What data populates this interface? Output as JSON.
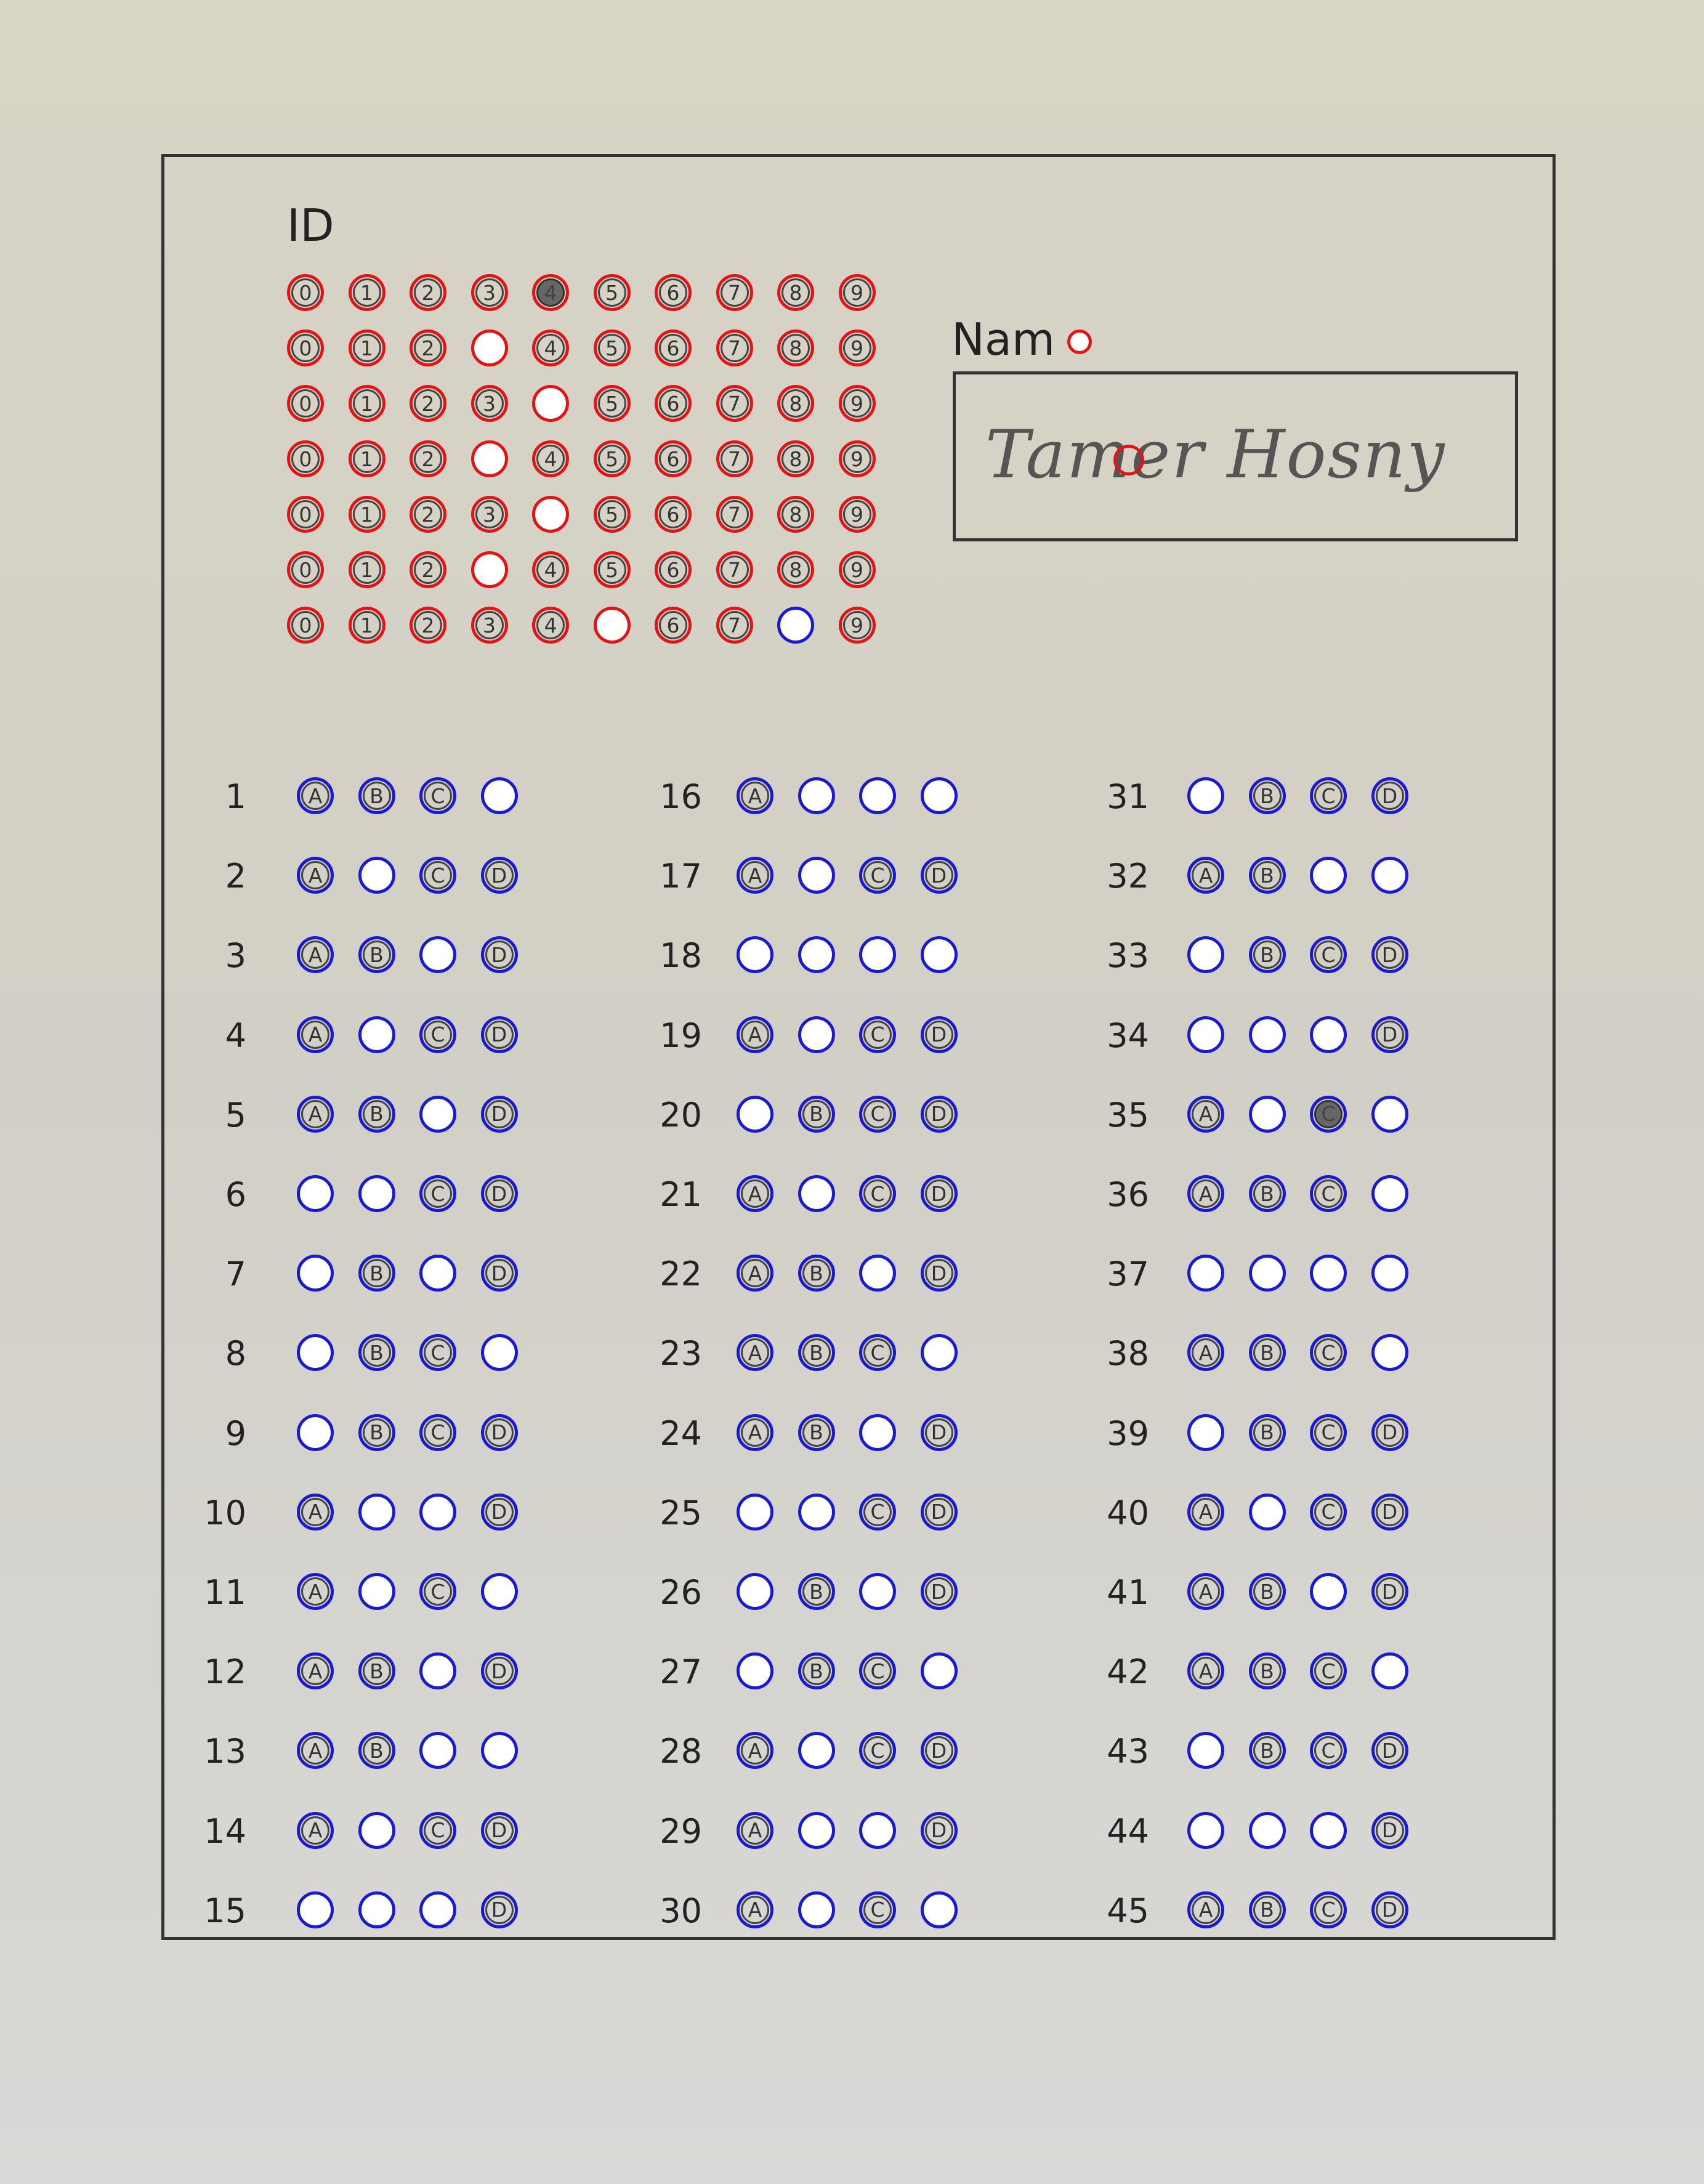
{
  "id_section": {
    "title": "ID",
    "digits": [
      "0",
      "1",
      "2",
      "3",
      "4",
      "5",
      "6",
      "7",
      "8",
      "9"
    ],
    "rows": [
      {
        "marked": 4,
        "mark_style": "filled",
        "ring": "red"
      },
      {
        "marked": 3,
        "mark_style": "empty",
        "ring": "red"
      },
      {
        "marked": 4,
        "mark_style": "empty",
        "ring": "red"
      },
      {
        "marked": 3,
        "mark_style": "empty",
        "ring": "red"
      },
      {
        "marked": 4,
        "mark_style": "empty",
        "ring": "red"
      },
      {
        "marked": 3,
        "mark_style": "empty",
        "ring": "red"
      },
      {
        "marked": 5,
        "mark_style": "empty",
        "ring": "red",
        "extra_empty": 8
      }
    ]
  },
  "name_section": {
    "label": "Nam",
    "value": "Tamer Hosny"
  },
  "answers": {
    "options": [
      "A",
      "B",
      "C",
      "D"
    ],
    "questions": [
      {
        "n": "1",
        "empty": [
          3
        ]
      },
      {
        "n": "2",
        "empty": [
          1
        ]
      },
      {
        "n": "3",
        "empty": [
          2
        ]
      },
      {
        "n": "4",
        "empty": [
          1
        ]
      },
      {
        "n": "5",
        "empty": [
          2
        ]
      },
      {
        "n": "6",
        "empty": [
          0,
          1
        ]
      },
      {
        "n": "7",
        "empty": [
          0,
          2
        ]
      },
      {
        "n": "8",
        "empty": [
          0,
          3
        ]
      },
      {
        "n": "9",
        "empty": [
          0
        ]
      },
      {
        "n": "10",
        "empty": [
          1,
          2
        ]
      },
      {
        "n": "11",
        "empty": [
          1,
          3
        ]
      },
      {
        "n": "12",
        "empty": [
          2
        ]
      },
      {
        "n": "13",
        "empty": [
          2,
          3
        ]
      },
      {
        "n": "14",
        "empty": [
          1
        ]
      },
      {
        "n": "15",
        "empty": [
          0,
          1,
          2
        ]
      },
      {
        "n": "16",
        "empty": [
          1,
          2,
          3
        ]
      },
      {
        "n": "17",
        "empty": [
          1
        ]
      },
      {
        "n": "18",
        "empty": [
          0,
          1,
          2,
          3
        ]
      },
      {
        "n": "19",
        "empty": [
          1
        ]
      },
      {
        "n": "20",
        "empty": [
          0
        ]
      },
      {
        "n": "21",
        "empty": [
          1
        ]
      },
      {
        "n": "22",
        "empty": [
          2
        ]
      },
      {
        "n": "23",
        "empty": [
          3
        ]
      },
      {
        "n": "24",
        "empty": [
          2
        ]
      },
      {
        "n": "25",
        "empty": [
          0,
          1
        ]
      },
      {
        "n": "26",
        "empty": [
          0,
          2
        ]
      },
      {
        "n": "27",
        "empty": [
          0,
          3
        ]
      },
      {
        "n": "28",
        "empty": [
          1
        ]
      },
      {
        "n": "29",
        "empty": [
          1,
          2
        ]
      },
      {
        "n": "30",
        "empty": [
          1,
          3
        ]
      },
      {
        "n": "31",
        "empty": [
          0
        ]
      },
      {
        "n": "32",
        "empty": [
          2,
          3
        ]
      },
      {
        "n": "33",
        "empty": [
          0
        ]
      },
      {
        "n": "34",
        "empty": [
          0,
          1,
          2
        ]
      },
      {
        "n": "35",
        "empty": [
          1,
          3
        ],
        "filled": [
          2
        ]
      },
      {
        "n": "36",
        "empty": [
          3
        ]
      },
      {
        "n": "37",
        "empty": [
          0,
          1,
          2,
          3
        ]
      },
      {
        "n": "38",
        "empty": [
          3
        ]
      },
      {
        "n": "39",
        "empty": [
          0
        ]
      },
      {
        "n": "40",
        "empty": [
          1
        ]
      },
      {
        "n": "41",
        "empty": [
          2
        ]
      },
      {
        "n": "42",
        "empty": [
          3
        ]
      },
      {
        "n": "43",
        "empty": [
          0
        ]
      },
      {
        "n": "44",
        "empty": [
          0,
          1,
          2
        ]
      },
      {
        "n": "45",
        "empty": []
      }
    ]
  },
  "colors": {
    "id_ring": "#e01616",
    "answer_ring": "#1a1ad0",
    "fill": "#666666"
  }
}
